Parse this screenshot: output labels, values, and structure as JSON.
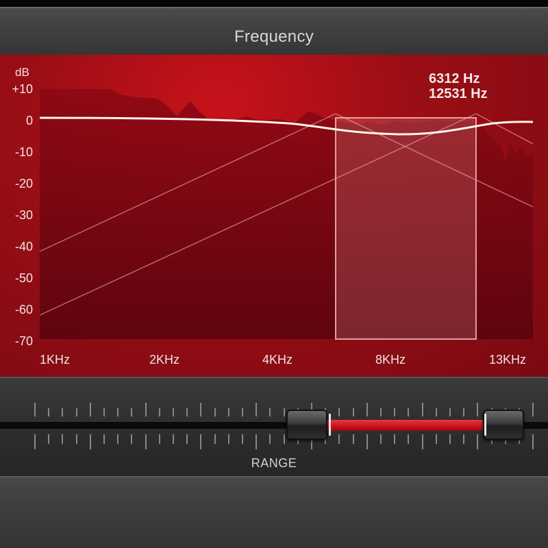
{
  "header": {
    "title": "Frequency"
  },
  "graph": {
    "y_unit": "dB",
    "y_ticks": [
      "+10",
      "0",
      "-10",
      "-20",
      "-30",
      "-40",
      "-50",
      "-60",
      "-70"
    ],
    "x_ticks": [
      "1KHz",
      "2KHz",
      "4KHz",
      "8KHz",
      "13KHz"
    ],
    "readout_low": "6312 Hz",
    "readout_high": "12531 Hz",
    "selection_low_fraction": 0.6,
    "selection_high_fraction": 0.885
  },
  "slider": {
    "label": "RANGE",
    "low_fraction": 0.6,
    "high_fraction": 0.885
  },
  "colors": {
    "accent": "#c8101c",
    "screen": "#9c0e15",
    "curve": "#fff5ec"
  }
}
